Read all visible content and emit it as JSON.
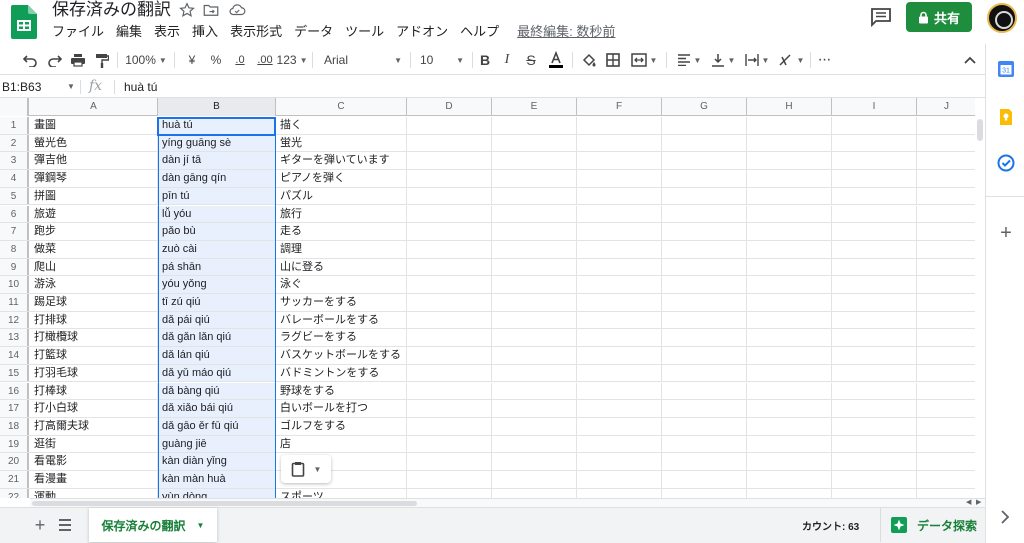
{
  "app": {
    "title": "保存済みの翻訳",
    "menu": [
      "ファイル",
      "編集",
      "表示",
      "挿入",
      "表示形式",
      "データ",
      "ツール",
      "アドオン",
      "ヘルプ"
    ],
    "last_edit": "最終編集: 数秒前",
    "share_label": "共有",
    "colors": {
      "brand_green": "#1e8e3e",
      "selection_blue": "#1a73e8",
      "selection_fill": "#e8f0fe"
    }
  },
  "toolbar": {
    "zoom": "100%",
    "currency": "¥",
    "percent": "%",
    "decimal_decrease": ".0",
    "decimal_increase": ".00",
    "more_formats": "123",
    "font": "Arial",
    "font_size": "10",
    "icons": [
      "undo-icon",
      "redo-icon",
      "print-icon",
      "paint-format-icon",
      "bold-icon",
      "italic-icon",
      "strikethrough-icon",
      "text-color-icon",
      "fill-color-icon",
      "borders-icon",
      "merge-cells-icon",
      "align-left-icon",
      "valign-bottom-icon",
      "text-wrap-icon",
      "text-rotate-icon",
      "more-icon",
      "collapse-icon"
    ]
  },
  "formula_bar": {
    "name_box": "B1:B63",
    "fx": "fx",
    "content": "huà tú"
  },
  "columns": [
    "A",
    "B",
    "C",
    "D",
    "E",
    "F",
    "G",
    "H",
    "I",
    "J"
  ],
  "rows": [
    {
      "n": "1",
      "a": "畫圖",
      "b": "huà tú",
      "c": "描く"
    },
    {
      "n": "2",
      "a": "螢光色",
      "b": "yíng guāng sè",
      "c": "蛍光"
    },
    {
      "n": "3",
      "a": "彈吉他",
      "b": "dàn jí tā",
      "c": "ギターを弾いています"
    },
    {
      "n": "4",
      "a": "彈鋼琴",
      "b": "dàn gāng qín",
      "c": "ピアノを弾く"
    },
    {
      "n": "5",
      "a": "拼圖",
      "b": "pīn tú",
      "c": "パズル"
    },
    {
      "n": "6",
      "a": "旅遊",
      "b": "lǚ yóu",
      "c": "旅行"
    },
    {
      "n": "7",
      "a": "跑步",
      "b": "pǎo bù",
      "c": "走る"
    },
    {
      "n": "8",
      "a": "做菜",
      "b": "zuò cài",
      "c": "調理"
    },
    {
      "n": "9",
      "a": "爬山",
      "b": "pá shān",
      "c": "山に登る"
    },
    {
      "n": "10",
      "a": "游泳",
      "b": "yóu yǒng",
      "c": "泳ぐ"
    },
    {
      "n": "11",
      "a": "踢足球",
      "b": "tī zú qiú",
      "c": "サッカーをする"
    },
    {
      "n": "12",
      "a": "打排球",
      "b": "dǎ pái qiú",
      "c": "バレーボールをする"
    },
    {
      "n": "13",
      "a": "打橄欖球",
      "b": "dǎ gǎn lǎn qiú",
      "c": "ラグビーをする"
    },
    {
      "n": "14",
      "a": "打籃球",
      "b": "dǎ lán qiú",
      "c": "バスケットボールをする"
    },
    {
      "n": "15",
      "a": "打羽毛球",
      "b": "dǎ yǔ máo qiú",
      "c": "バドミントンをする"
    },
    {
      "n": "16",
      "a": "打棒球",
      "b": "dǎ bàng qiú",
      "c": "野球をする"
    },
    {
      "n": "17",
      "a": "打小白球",
      "b": "dǎ xiǎo bái qiú",
      "c": "白いボールを打つ"
    },
    {
      "n": "18",
      "a": "打高爾夫球",
      "b": "dǎ gāo ěr fū qiú",
      "c": "ゴルフをする"
    },
    {
      "n": "19",
      "a": "逛街",
      "b": "guàng jiē",
      "c": "店"
    },
    {
      "n": "20",
      "a": "看電影",
      "b": "kàn diàn yǐng",
      "c": ""
    },
    {
      "n": "21",
      "a": "看漫畫",
      "b": "kàn màn huà",
      "c": ""
    },
    {
      "n": "22",
      "a": "運動",
      "b": "yùn dòng",
      "c": "スポーツ"
    }
  ],
  "sheet": {
    "tab_label": "保存済みの翻訳",
    "count": "カウント: 63",
    "explore_label": "データ探索"
  }
}
